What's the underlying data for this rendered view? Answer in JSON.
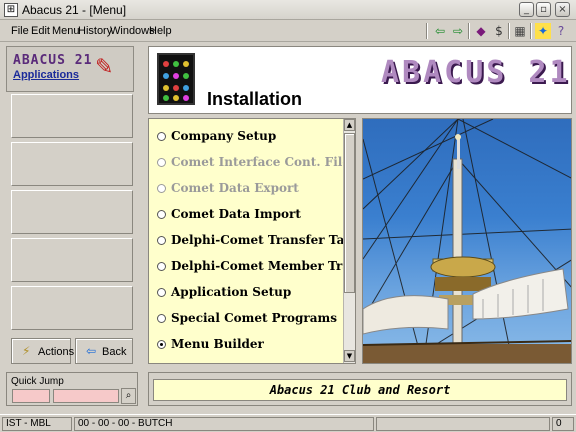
{
  "window": {
    "title": "Abacus 21 - [Menu]"
  },
  "menu": [
    "File",
    "Edit",
    "Menu",
    "History",
    "Windows",
    "Help"
  ],
  "toolbar_icons": [
    "back-arrow-icon",
    "forward-arrow-icon",
    "book-icon",
    "dollar-icon",
    "calculator-icon",
    "run-icon",
    "help-icon"
  ],
  "logo": {
    "line1": "ABACUS 21",
    "line2": "Applications"
  },
  "buttons": {
    "actions": "Actions",
    "back": "Back"
  },
  "header": {
    "title": "Installation",
    "brand": "ABACUS 21"
  },
  "list": [
    {
      "label": "Company Setup",
      "enabled": true,
      "selected": false
    },
    {
      "label": "Comet Interface Cont. File Ma",
      "enabled": false,
      "selected": false
    },
    {
      "label": "Comet Data Export",
      "enabled": false,
      "selected": false
    },
    {
      "label": "Comet Data Import",
      "enabled": true,
      "selected": false
    },
    {
      "label": "Delphi-Comet Transfer Tables",
      "enabled": true,
      "selected": false
    },
    {
      "label": "Delphi-Comet Member Transf",
      "enabled": true,
      "selected": false
    },
    {
      "label": "Application Setup",
      "enabled": true,
      "selected": false
    },
    {
      "label": "Special Comet Programs",
      "enabled": true,
      "selected": false
    },
    {
      "label": "Menu Builder",
      "enabled": true,
      "selected": true
    }
  ],
  "quick_jump": {
    "label": "Quick Jump",
    "field1": "",
    "field2": ""
  },
  "banner": "Abacus 21 Club and Resort",
  "status": {
    "left": "IST - MBL",
    "middle": "00 - 00 - 00 - BUTCH",
    "right": "0"
  }
}
